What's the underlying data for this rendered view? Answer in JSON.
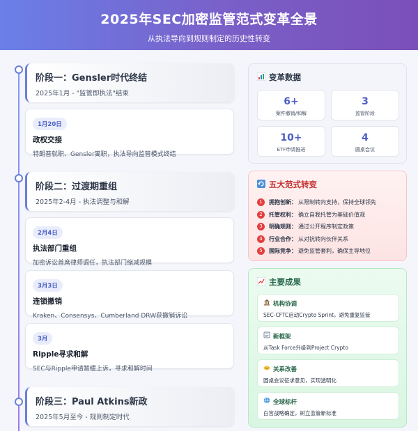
{
  "header": {
    "title": "2025年SEC加密监管范式变革全景",
    "subtitle": "从执法导向到规则制定的历史性转变"
  },
  "timeline": {
    "phases": [
      {
        "title": "阶段一：Gensler时代终结",
        "subtitle": "2025年1月 - \"监管即执法\"结束"
      },
      {
        "title": "阶段二：过渡期重组",
        "subtitle": "2025年2-4月 - 执法调整与和解"
      },
      {
        "title": "阶段三：Paul Atkins新政",
        "subtitle": "2025年5月至今 - 规则制定时代"
      }
    ],
    "events": [
      {
        "date": "1月20日",
        "title": "政权交接",
        "desc": "特朗普就职、Gensler离职，执法导向监管模式终结"
      },
      {
        "date": "2月4日",
        "title": "执法部门重组",
        "desc": "加密诉讼首席律师调任，执法部门缩减规模"
      },
      {
        "date": "3月3日",
        "title": "连锁撤销",
        "desc": "Kraken、Consensys、Cumberland DRW获撤销诉讼"
      },
      {
        "date": "3月",
        "title": "Ripple寻求和解",
        "desc": "SEC与Ripple申请暂缓上诉，寻求和解时间"
      }
    ]
  },
  "stats": {
    "title": "变革数据",
    "items": [
      {
        "value": "6+",
        "label": "案件撤销/和解"
      },
      {
        "value": "3",
        "label": "监管阶段"
      },
      {
        "value": "10+",
        "label": "ETF申请推进"
      },
      {
        "value": "4",
        "label": "圆桌会议"
      }
    ]
  },
  "shifts": {
    "title": "五大范式转变",
    "items": [
      {
        "num": "1",
        "name": "拥抱创新：",
        "text": "从限制转向支持，保持全球领先"
      },
      {
        "num": "2",
        "name": "托管权利：",
        "text": "确立自我托管为基础价值观"
      },
      {
        "num": "3",
        "name": "明确规则：",
        "text": "通过公开程序制定政策"
      },
      {
        "num": "4",
        "name": "行业合作：",
        "text": "从对抗转向伙伴关系"
      },
      {
        "num": "5",
        "name": "国际竞争：",
        "text": "避免监管套利，确保主导地位"
      }
    ]
  },
  "results": {
    "title": "主要成果",
    "items": [
      {
        "icon": "institution-icon",
        "title": "机构协调",
        "desc": "SEC-CFTC启动Crypto Sprint，避免重复监管"
      },
      {
        "icon": "framework-icon",
        "title": "新框架",
        "desc": "从Task Force升级到Project Crypto"
      },
      {
        "icon": "handshake-icon",
        "title": "关系改善",
        "desc": "圆桌会议征求意见，实现透明化"
      },
      {
        "icon": "globe-icon",
        "title": "全球标杆",
        "desc": "白宫战略确定，树立监管新标准"
      }
    ]
  },
  "colors": {
    "accent": "#4c5fc4",
    "danger": "#c53030",
    "success": "#276749"
  }
}
